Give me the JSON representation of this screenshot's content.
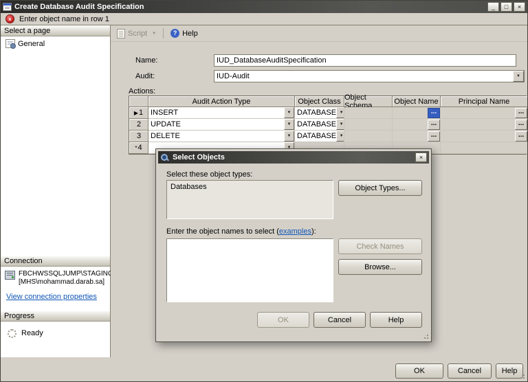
{
  "window": {
    "title": "Create Database Audit Specification"
  },
  "icons": {
    "minimize": "_",
    "maximize": "□",
    "close": "×",
    "dropdown": "▼",
    "error_glyph": "×",
    "help_glyph": "?"
  },
  "notification": {
    "message": "Enter object name in row 1"
  },
  "toolbar": {
    "script": "Script",
    "help": "Help"
  },
  "sidebar": {
    "select_page": "Select a page",
    "general": "General",
    "connection_header": "Connection",
    "server": "FBCHWSSQLJUMP\\STAGING",
    "server_user": "[MHS\\mohammad.darab.sa]",
    "view_link": "View connection properties",
    "progress_header": "Progress",
    "status": "Ready"
  },
  "form": {
    "name_label": "Name:",
    "name_value": "IUD_DatabaseAuditSpecification",
    "audit_label": "Audit:",
    "audit_value": "IUD-Audit",
    "actions_label": "Actions:"
  },
  "grid": {
    "headers": {
      "action": "Audit Action Type",
      "class": "Object Class",
      "schema": "Object Schema",
      "name": "Object Name",
      "principal": "Principal Name"
    },
    "rows": [
      {
        "marker": "▶",
        "num": "1",
        "action": "INSERT",
        "class": "DATABASE"
      },
      {
        "marker": "",
        "num": "2",
        "action": "UPDATE",
        "class": "DATABASE"
      },
      {
        "marker": "",
        "num": "3",
        "action": "DELETE",
        "class": "DATABASE"
      },
      {
        "marker": "*",
        "num": "4",
        "action": "",
        "class": ""
      }
    ],
    "browse": "..."
  },
  "dialog": {
    "title": "Select Objects",
    "types_label": "Select these object types:",
    "types_value": "Databases",
    "object_types_btn": "Object Types...",
    "names_prefix": "Enter the object names to select (",
    "names_link": "examples",
    "names_suffix": "):",
    "check_names_btn": "Check Names",
    "browse_btn": "Browse...",
    "ok": "OK",
    "cancel": "Cancel",
    "help": "Help"
  },
  "footer": {
    "ok": "OK",
    "cancel": "Cancel",
    "help": "Help"
  },
  "colors": {
    "titlebar": "#3c3c3a",
    "window_face": "#d4d0c8",
    "error_red": "#c21d1d",
    "link_blue": "#0f55b5",
    "selection_blue": "#355ec0"
  }
}
